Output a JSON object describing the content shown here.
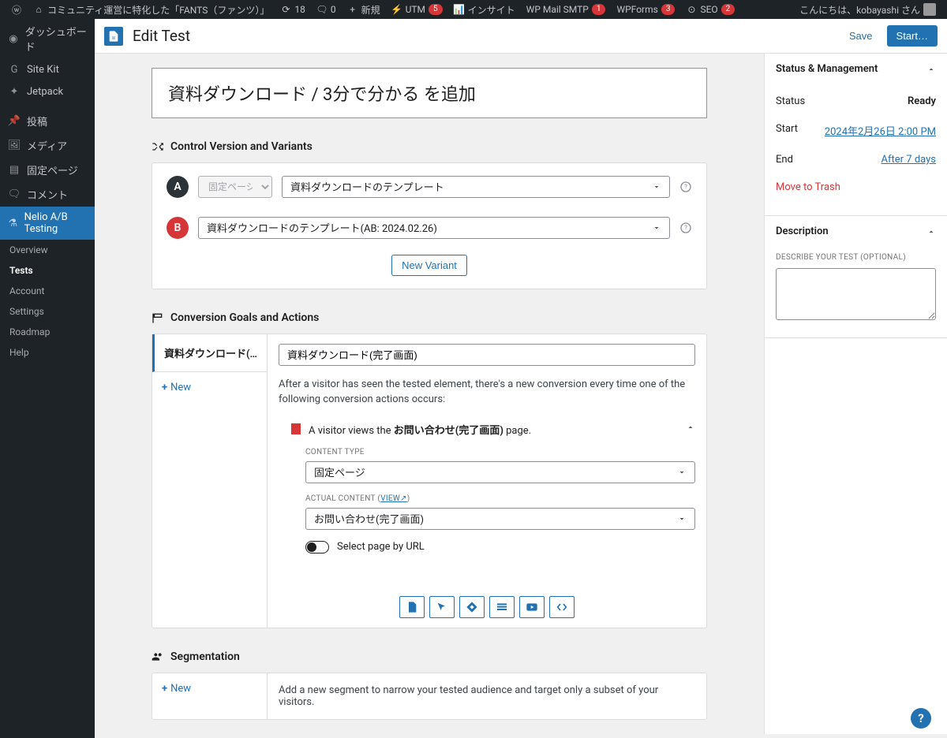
{
  "adminbar": {
    "site_title": "コミュニティ運営に特化した「FANTS（ファンツ）」",
    "updates": "18",
    "comments": "0",
    "new": "新規",
    "utm": "UTM",
    "utm_badge": "5",
    "insights": "インサイト",
    "wpmail": "WP Mail SMTP",
    "wpmail_badge": "1",
    "wpforms": "WPForms",
    "wpforms_badge": "3",
    "seo": "SEO",
    "seo_badge": "2",
    "greeting": "こんにちは、kobayashi さん"
  },
  "sidebar": {
    "dashboard": "ダッシュボード",
    "sitekit": "Site Kit",
    "jetpack": "Jetpack",
    "posts": "投稿",
    "media": "メディア",
    "pages": "固定ページ",
    "comments": "コメント",
    "nelio": "Nelio A/B Testing",
    "sub_overview": "Overview",
    "sub_tests": "Tests",
    "sub_account": "Account",
    "sub_settings": "Settings",
    "sub_roadmap": "Roadmap",
    "sub_help": "Help"
  },
  "editor": {
    "title": "Edit Test",
    "save": "Save",
    "start": "Start…"
  },
  "test": {
    "title_value": "資料ダウンロード / 3分で分かる を追加"
  },
  "variants": {
    "heading": "Control Version and Variants",
    "a_letter": "A",
    "a_type": "固定ページ",
    "a_content": "資料ダウンロードのテンプレート",
    "b_letter": "B",
    "b_content": "資料ダウンロードのテンプレート(AB: 2024.02.26)",
    "new_button": "New Variant"
  },
  "goals": {
    "heading": "Conversion Goals and Actions",
    "tab1": "資料ダウンロード(完…",
    "new": "New",
    "goal_name": "資料ダウンロード(完了画面)",
    "after_text": "After a visitor has seen the tested element, there's a new conversion every time one of the following conversion actions occurs:",
    "action_prefix": "A visitor views the ",
    "action_bold": "お問い合わせ(完了画面)",
    "action_suffix": " page.",
    "content_type_label": "CONTENT TYPE",
    "content_type_value": "固定ページ",
    "actual_content_label": "ACTUAL CONTENT",
    "view": "VIEW",
    "actual_content_value": "お問い合わせ(完了画面)",
    "select_by_url": "Select page by URL"
  },
  "segmentation": {
    "heading": "Segmentation",
    "new": "New",
    "desc": "Add a new segment to narrow your tested audience and target only a subset of your visitors."
  },
  "panel": {
    "status_heading": "Status & Management",
    "status_label": "Status",
    "status_value": "Ready",
    "start_label": "Start",
    "start_value": "2024年2月26日 2:00 PM",
    "end_label": "End",
    "end_value": "After 7 days",
    "trash": "Move to Trash",
    "desc_heading": "Description",
    "desc_label": "DESCRIBE YOUR TEST (OPTIONAL)"
  }
}
